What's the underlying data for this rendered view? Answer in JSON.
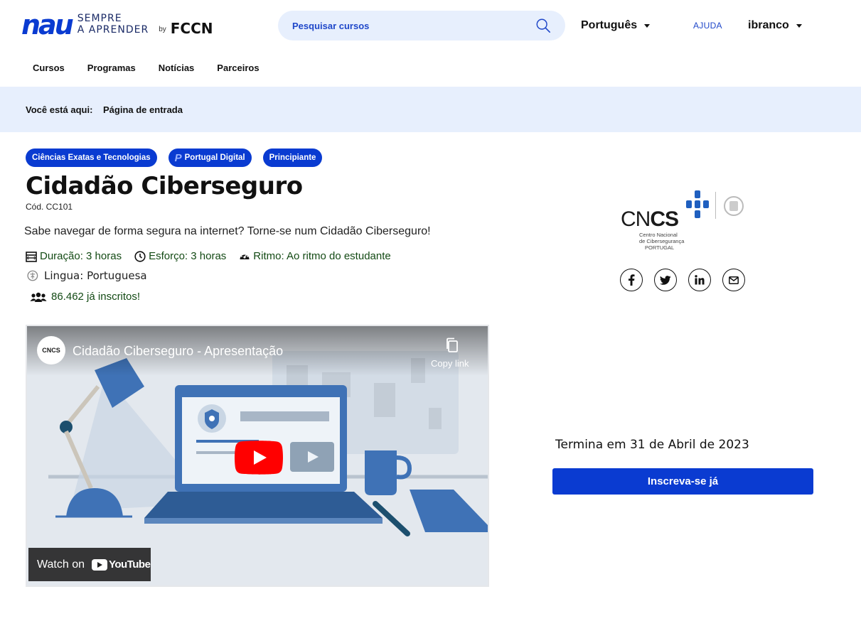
{
  "brand": {
    "mark": "nau",
    "tagline_line1": "SEMPRE",
    "tagline_line2": "A APRENDER",
    "by": "by",
    "partner": "FCCN"
  },
  "search": {
    "placeholder": "Pesquisar cursos",
    "value": ""
  },
  "header": {
    "language": "Português",
    "help": "AJUDA",
    "username": "ibranco"
  },
  "nav": {
    "items": [
      "Cursos",
      "Programas",
      "Notícias",
      "Parceiros"
    ]
  },
  "breadcrumb": {
    "label": "Você está aqui:",
    "current": "Página de entrada"
  },
  "course": {
    "tags": [
      "Ciências Exatas e Tecnologias",
      "Portugal Digital",
      "Principiante"
    ],
    "title": "Cidadão Ciberseguro",
    "code": "Cód. CC101",
    "description": "Sabe navegar de forma segura na internet? Torne-se num Cidadão Ciberseguro!",
    "duration": "Duração: 3 horas",
    "effort": "Esforço: 3 horas",
    "pace": "Ritmo: Ao ritmo do estudante",
    "language": "Lingua: Portuguesa",
    "enrolled": "86.462 já inscritos!"
  },
  "video": {
    "channel": "CNCS",
    "title": "Cidadão Ciberseguro - Apresentação",
    "copy_link": "Copy link",
    "watch_on": "Watch on",
    "youtube": "YouTube"
  },
  "organization": {
    "short_prefix": "CN",
    "short_bold": "CS",
    "subline1": "Centro Nacional",
    "subline2": "de Cibersegurança",
    "subline3": "PORTUGAL"
  },
  "sidebar": {
    "ends": "Termina em 31 de Abril de 2023",
    "enroll": "Inscreva-se já"
  },
  "colors": {
    "brand_blue": "#0a3bd1",
    "light_blue": "#e7effd",
    "meta_green": "#134a14"
  }
}
